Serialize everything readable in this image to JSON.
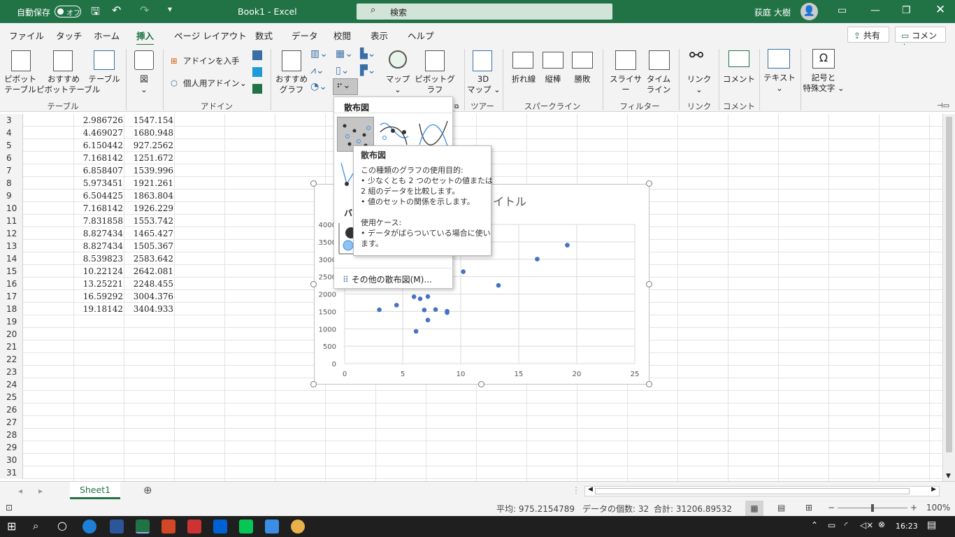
{
  "title_bar": {
    "autosave_label": "自動保存",
    "autosave_state": "オフ",
    "doc_title": "Book1 - Excel",
    "search_placeholder": "検索",
    "user_name": "荻庭 大樹"
  },
  "menu": {
    "tabs": [
      "ファイル",
      "タッチ",
      "ホーム",
      "挿入",
      "ページ レイアウト",
      "数式",
      "データ",
      "校閲",
      "表示",
      "ヘルプ"
    ],
    "active_tab": "挿入",
    "share_label": "共有",
    "comment_label": "コメント"
  },
  "ribbon": {
    "buttons": {
      "pivot_table": "ピボット\nテーブル",
      "recommended_pivot": "おすすめ\nピボットテーブル",
      "table": "テーブル",
      "figure": "図",
      "get_addins": "アドインを入手",
      "my_addins": "個人用アドイン",
      "recommended_charts": "おすすめ\nグラフ",
      "maps": "マップ",
      "pivot_chart": "ピボットグラフ",
      "map3d": "3D\nマップ",
      "line_spark": "折れ線",
      "column_spark": "縦棒",
      "winloss_spark": "勝敗",
      "slicer": "スライサー",
      "timeline": "タイム\nライン",
      "link": "リンク",
      "comment": "コメント",
      "text": "テキスト",
      "symbols": "記号と\n特殊文字"
    },
    "groups": {
      "tables": "テーブル",
      "addins": "アドイン",
      "tours": "ツアー",
      "sparklines": "スパークライン",
      "filters": "フィルター",
      "links": "リンク",
      "comments": "コメント"
    }
  },
  "sheet": {
    "rows": [
      {
        "n": "3",
        "a": "2.986726",
        "b": "1547.154"
      },
      {
        "n": "4",
        "a": "4.469027",
        "b": "1680.948"
      },
      {
        "n": "5",
        "a": "6.150442",
        "b": "927.2562"
      },
      {
        "n": "6",
        "a": "7.168142",
        "b": "1251.672"
      },
      {
        "n": "7",
        "a": "6.858407",
        "b": "1539.996"
      },
      {
        "n": "8",
        "a": "5.973451",
        "b": "1921.261"
      },
      {
        "n": "9",
        "a": "6.504425",
        "b": "1863.804"
      },
      {
        "n": "10",
        "a": "7.168142",
        "b": "1926.229"
      },
      {
        "n": "11",
        "a": "7.831858",
        "b": "1553.742"
      },
      {
        "n": "12",
        "a": "8.827434",
        "b": "1465.427"
      },
      {
        "n": "13",
        "a": "8.827434",
        "b": "1505.367"
      },
      {
        "n": "14",
        "a": "8.539823",
        "b": "2583.642"
      },
      {
        "n": "15",
        "a": "10.22124",
        "b": "2642.081"
      },
      {
        "n": "16",
        "a": "13.25221",
        "b": "2248.455"
      },
      {
        "n": "17",
        "a": "16.59292",
        "b": "3004.376"
      },
      {
        "n": "18",
        "a": "19.18142",
        "b": "3404.933"
      },
      {
        "n": "19",
        "a": "",
        "b": ""
      },
      {
        "n": "20",
        "a": "",
        "b": ""
      },
      {
        "n": "21",
        "a": "",
        "b": ""
      },
      {
        "n": "22",
        "a": "",
        "b": ""
      },
      {
        "n": "23",
        "a": "",
        "b": ""
      },
      {
        "n": "24",
        "a": "",
        "b": ""
      },
      {
        "n": "25",
        "a": "",
        "b": ""
      },
      {
        "n": "26",
        "a": "",
        "b": ""
      },
      {
        "n": "27",
        "a": "",
        "b": ""
      },
      {
        "n": "28",
        "a": "",
        "b": ""
      },
      {
        "n": "29",
        "a": "",
        "b": ""
      },
      {
        "n": "30",
        "a": "",
        "b": ""
      },
      {
        "n": "31",
        "a": "",
        "b": ""
      }
    ]
  },
  "chart_data": {
    "type": "scatter",
    "title_visible_fragment": "イトル",
    "xlim": [
      0,
      25
    ],
    "ylim": [
      0,
      4000
    ],
    "x_ticks": [
      "0",
      "5",
      "10",
      "15",
      "20",
      "25"
    ],
    "y_ticks": [
      "0",
      "500",
      "1000",
      "1500",
      "2000",
      "2500",
      "3000",
      "3500",
      "4000"
    ],
    "grid": true,
    "marker_color": "#4472c4",
    "points": [
      [
        2.986726,
        1547.154
      ],
      [
        4.469027,
        1680.948
      ],
      [
        6.150442,
        927.2562
      ],
      [
        7.168142,
        1251.672
      ],
      [
        6.858407,
        1539.996
      ],
      [
        5.973451,
        1921.261
      ],
      [
        6.504425,
        1863.804
      ],
      [
        7.168142,
        1926.229
      ],
      [
        7.831858,
        1553.742
      ],
      [
        8.827434,
        1465.427
      ],
      [
        8.827434,
        1505.367
      ],
      [
        8.539823,
        2583.642
      ],
      [
        10.22124,
        2642.081
      ],
      [
        13.25221,
        2248.455
      ],
      [
        16.59292,
        3004.376
      ],
      [
        19.18142,
        3404.933
      ]
    ]
  },
  "dropdown": {
    "header": "散布図",
    "section2_fragment": "バ",
    "more_label": "その他の散布図(M)..."
  },
  "tooltip": {
    "title": "散布図",
    "lines": [
      "この種類のグラフの使用目的:",
      "• 少なくとも 2 つのセットの値または",
      "2 組のデータを比較します。",
      "• 値のセットの関係を示します。",
      "",
      "使用ケース:",
      "• データがばらついている場合に使い",
      "ます。"
    ]
  },
  "tabs": {
    "sheet_name": "Sheet1"
  },
  "status": {
    "average": "平均: 975.2154789",
    "count": "データの個数: 32",
    "sum": "合計: 31206.89532",
    "zoom": "100%"
  },
  "taskbar": {
    "time": "16:23"
  }
}
